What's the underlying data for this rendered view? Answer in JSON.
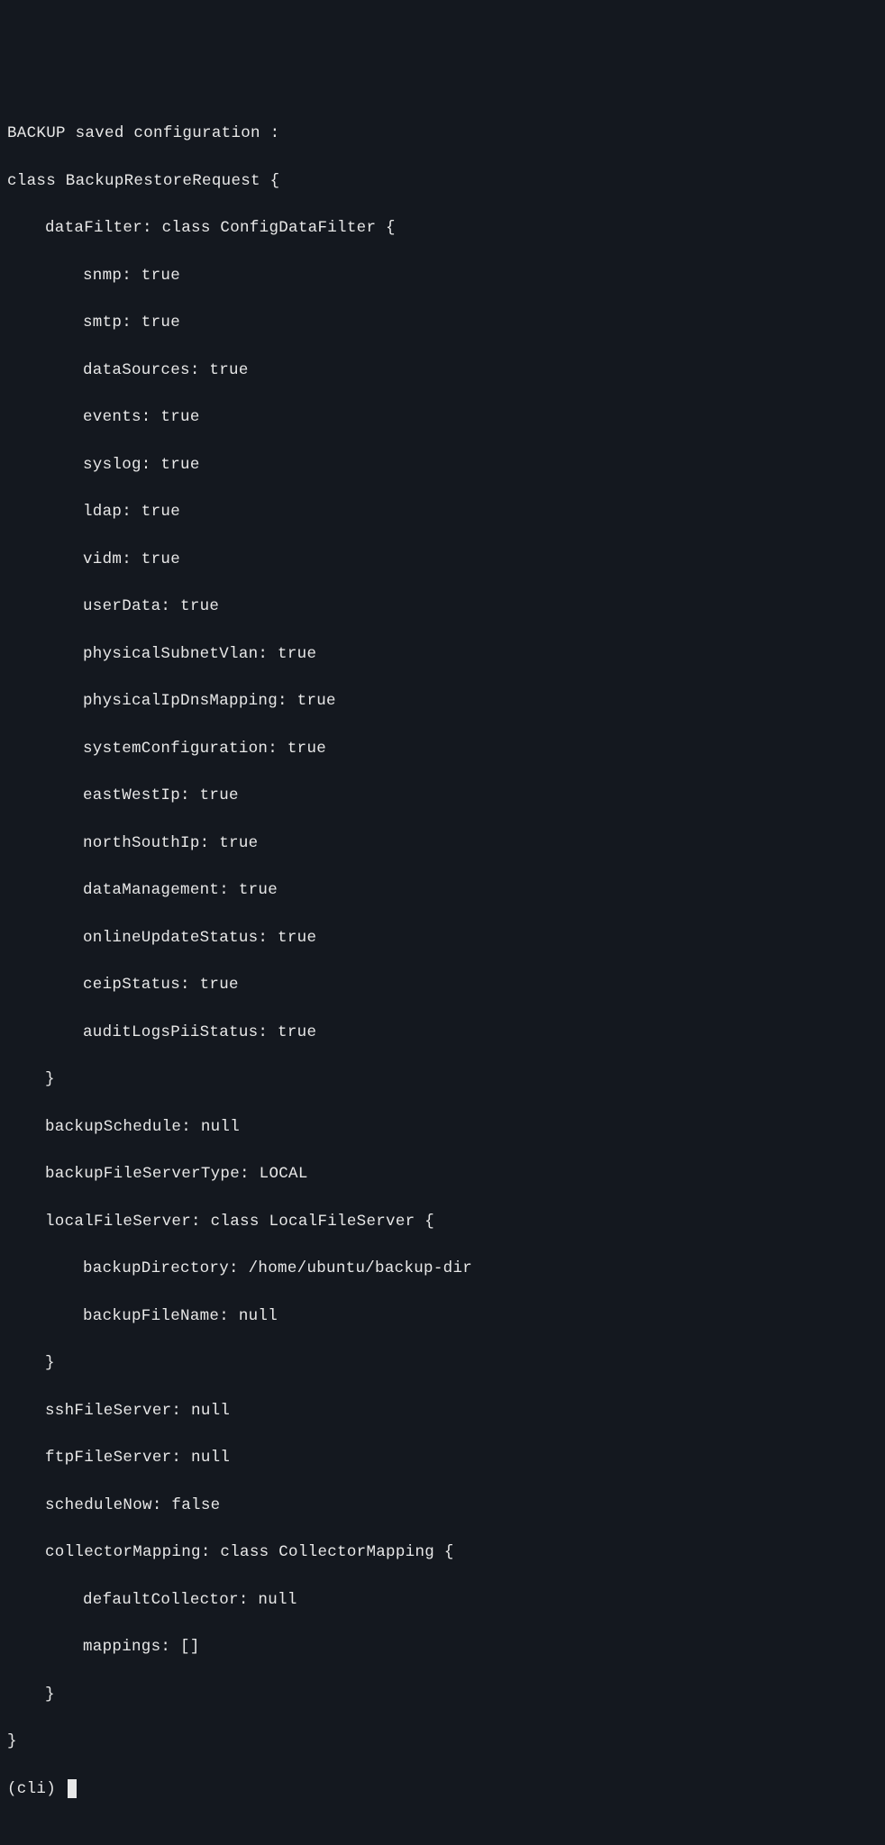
{
  "header": "BACKUP saved configuration :",
  "classDecl": "class BackupRestoreRequest {",
  "dataFilter": {
    "decl": "dataFilter: class ConfigDataFilter {",
    "fields": [
      "snmp: true",
      "smtp: true",
      "dataSources: true",
      "events: true",
      "syslog: true",
      "ldap: true",
      "vidm: true",
      "userData: true",
      "physicalSubnetVlan: true",
      "physicalIpDnsMapping: true",
      "systemConfiguration: true",
      "eastWestIp: true",
      "northSouthIp: true",
      "dataManagement: true",
      "onlineUpdateStatus: true",
      "ceipStatus: true",
      "auditLogsPiiStatus: true"
    ],
    "close": "}"
  },
  "backupSchedule": "backupSchedule: null",
  "backupFileServerType": "backupFileServerType: LOCAL",
  "localFileServer": {
    "decl": "localFileServer: class LocalFileServer {",
    "backupDirectory": "backupDirectory: /home/ubuntu/backup-dir",
    "backupFileName": "backupFileName: null",
    "close": "}"
  },
  "sshFileServer": "sshFileServer: null",
  "ftpFileServer": "ftpFileServer: null",
  "scheduleNow": "scheduleNow: false",
  "collectorMapping": {
    "decl": "collectorMapping: class CollectorMapping {",
    "defaultCollector": "defaultCollector: null",
    "mappings": "mappings: []",
    "close": "}"
  },
  "closeOuter": "}",
  "prompt": "(cli) "
}
